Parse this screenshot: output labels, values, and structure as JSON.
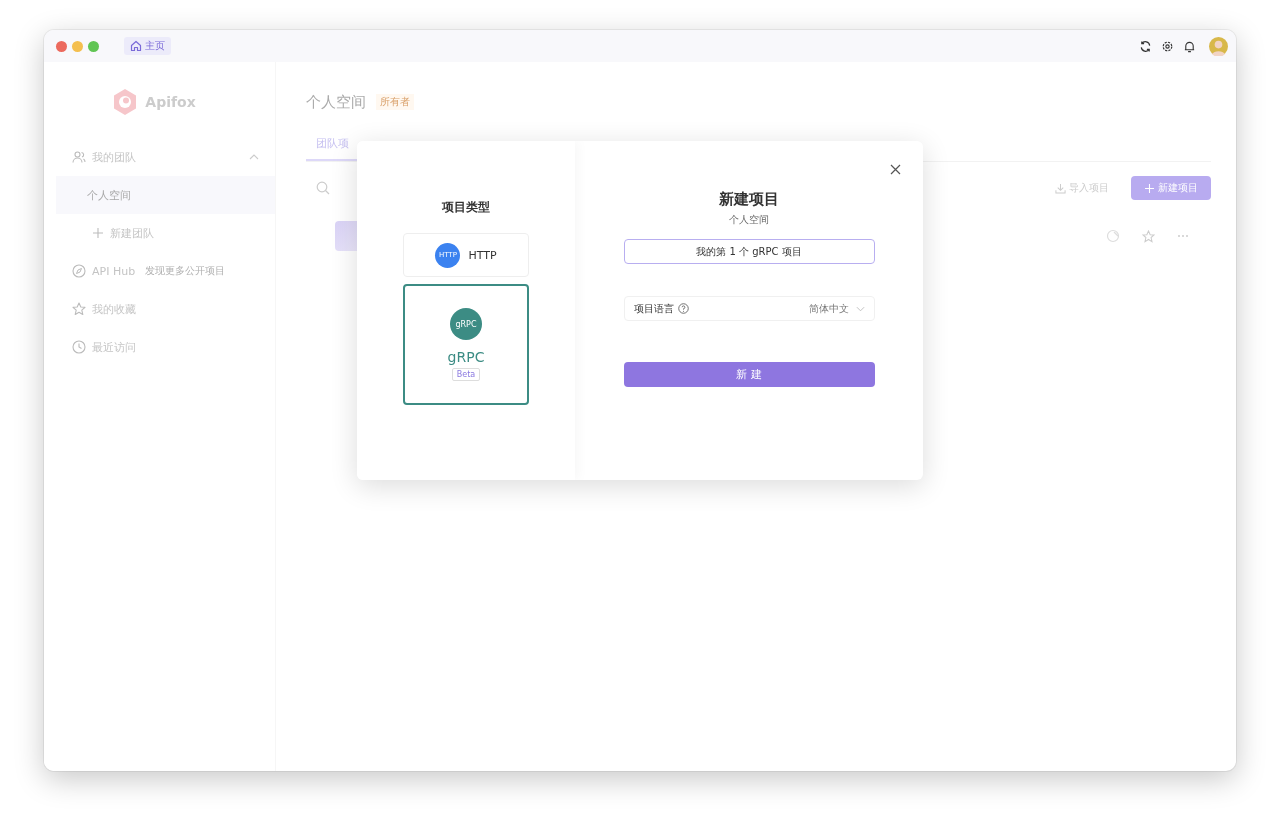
{
  "window": {
    "tabs": [
      {
        "label": "主页",
        "selected": true
      }
    ]
  },
  "sidebar": {
    "logo": "Apifox",
    "items": [
      {
        "kind": "team",
        "label": "我的团队",
        "expanded": true,
        "selected": false
      },
      {
        "kind": "space",
        "label": "个人空间",
        "selected": true
      },
      {
        "kind": "add",
        "label": "新建团队",
        "selected": false
      },
      {
        "kind": "hub",
        "label": "API Hub",
        "hint": "发现更多公开项目",
        "selected": false
      },
      {
        "kind": "favorites",
        "label": "我的收藏",
        "selected": false
      },
      {
        "kind": "recent",
        "label": "最近访问",
        "selected": false
      }
    ]
  },
  "main": {
    "title": "个人空间",
    "badge": "所有者",
    "tabs": [
      {
        "label": "团队项",
        "selected": true
      }
    ],
    "import": "导入项目",
    "new_project": "新建项目"
  },
  "modal": {
    "type_title": "项目类型",
    "types": [
      {
        "kind": "http",
        "icon_text": "HTTP",
        "label": "HTTP",
        "selected": false
      },
      {
        "kind": "grpc",
        "icon_text": "gRPC",
        "label": "gRPC",
        "badge": "Beta",
        "selected": true
      }
    ],
    "title": "新建项目",
    "subtitle": "个人空间",
    "name_value": "我的第 1 个 gRPC 项目",
    "language_label": "项目语言",
    "language_value": "简体中文",
    "submit": "新 建"
  }
}
